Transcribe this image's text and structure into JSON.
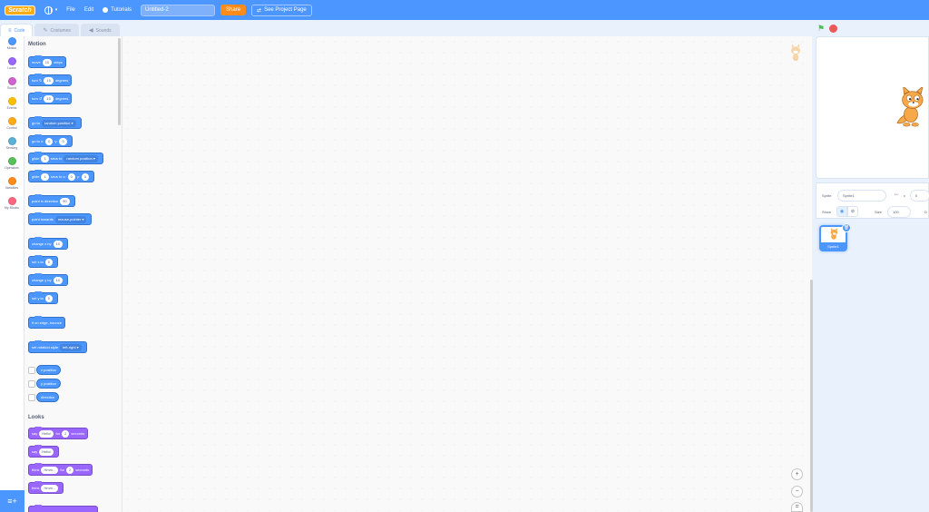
{
  "menubar": {
    "logo": "Scratch",
    "language_caret": "▾",
    "file": "File",
    "edit": "Edit",
    "tutorials": "Tutorials",
    "project_title": "Untitled-2",
    "share": "Share",
    "see_project_page": "See Project Page"
  },
  "tabs": {
    "code": "Code",
    "costumes": "Costumes",
    "sounds": "Sounds"
  },
  "categories": [
    {
      "label": "Motion",
      "color": "#4c97ff"
    },
    {
      "label": "Looks",
      "color": "#9966ff"
    },
    {
      "label": "Sound",
      "color": "#cf63cf"
    },
    {
      "label": "Events",
      "color": "#ffbf00"
    },
    {
      "label": "Control",
      "color": "#ffab19"
    },
    {
      "label": "Sensing",
      "color": "#5cb1d6"
    },
    {
      "label": "Operators",
      "color": "#59c059"
    },
    {
      "label": "Variables",
      "color": "#ff8c1a"
    },
    {
      "label": "My Blocks",
      "color": "#ff6680"
    }
  ],
  "flyout": {
    "motion_heading": "Motion",
    "looks_heading": "Looks",
    "blocks": {
      "move": {
        "a": "move",
        "v": "10",
        "b": "steps"
      },
      "turn_right": {
        "a": "turn ↻",
        "v": "15",
        "b": "degrees"
      },
      "turn_left": {
        "a": "turn ↺",
        "v": "15",
        "b": "degrees"
      },
      "go_to": {
        "a": "go to",
        "dd": "random position ▾"
      },
      "go_to_xy": {
        "a": "go to x:",
        "x": "0",
        "m": "y:",
        "y": "0"
      },
      "glide_to": {
        "a": "glide",
        "v": "1",
        "m": "secs to",
        "dd": "random position ▾"
      },
      "glide_xy": {
        "a": "glide",
        "v": "1",
        "m": "secs to x:",
        "x": "0",
        "n": "y:",
        "y": "0"
      },
      "point_dir": {
        "a": "point in direction",
        "v": "90"
      },
      "point_towards": {
        "a": "point towards",
        "dd": "mouse-pointer ▾"
      },
      "change_x": {
        "a": "change x by",
        "v": "10"
      },
      "set_x": {
        "a": "set x to",
        "v": "0"
      },
      "change_y": {
        "a": "change y by",
        "v": "10"
      },
      "set_y": {
        "a": "set y to",
        "v": "0"
      },
      "bounce": {
        "a": "if on edge, bounce"
      },
      "rotation": {
        "a": "set rotation style",
        "dd": "left-right ▾"
      },
      "x_position": "x position",
      "y_position": "y position",
      "direction": "direction",
      "say_for": {
        "a": "say",
        "v": "Hello!",
        "m": "for",
        "n": "2",
        "b": "seconds"
      },
      "say": {
        "a": "say",
        "v": "Hello!"
      },
      "think_for": {
        "a": "think",
        "v": "Hmm...",
        "m": "for",
        "n": "2",
        "b": "seconds"
      },
      "think": {
        "a": "think",
        "v": "Hmm..."
      }
    }
  },
  "stage": {
    "sprite_label": "Sprite",
    "sprite_name": "Sprite1",
    "x_label": "x",
    "x_value": "0",
    "show_label": "Show",
    "size_label": "Size",
    "size_value": "100",
    "direction_label": "D",
    "sprite_tile_name": "Sprite1"
  },
  "zoom": {
    "in": "+",
    "out": "−",
    "reset": "="
  }
}
